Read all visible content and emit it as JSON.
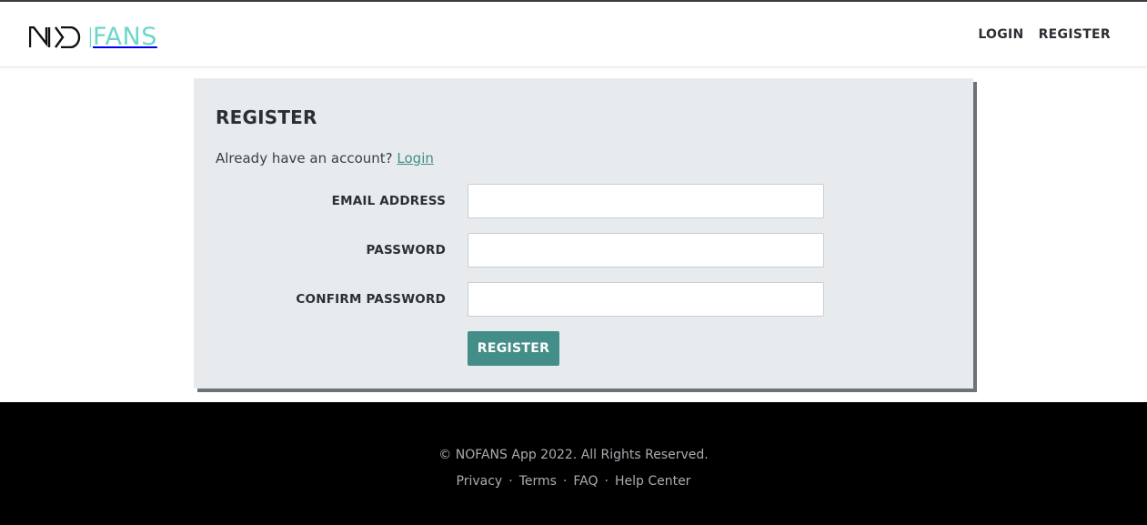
{
  "header": {
    "logo_suffix": "FANS",
    "logo_prefix_text": "NO",
    "nav": [
      {
        "label": "LOGIN"
      },
      {
        "label": "REGISTER"
      }
    ]
  },
  "card": {
    "title": "REGISTER",
    "account_prompt": "Already have an account?",
    "login_link": "Login",
    "fields": [
      {
        "label": "EMAIL ADDRESS",
        "value": "",
        "placeholder": ""
      },
      {
        "label": "PASSWORD",
        "value": "",
        "placeholder": ""
      },
      {
        "label": "CONFIRM PASSWORD",
        "value": "",
        "placeholder": ""
      }
    ],
    "submit_label": "REGISTER"
  },
  "footer": {
    "copyright": "© NOFANS App 2022. All Rights Reserved.",
    "links": [
      {
        "label": "Privacy"
      },
      {
        "label": "Terms"
      },
      {
        "label": "FAQ"
      },
      {
        "label": "Help Center"
      }
    ],
    "separator": "·"
  },
  "colors": {
    "accent": "#438e88",
    "logo_accent": "#6ed6cb",
    "card_bg": "#e8ebee",
    "footer_bg": "#000000"
  }
}
